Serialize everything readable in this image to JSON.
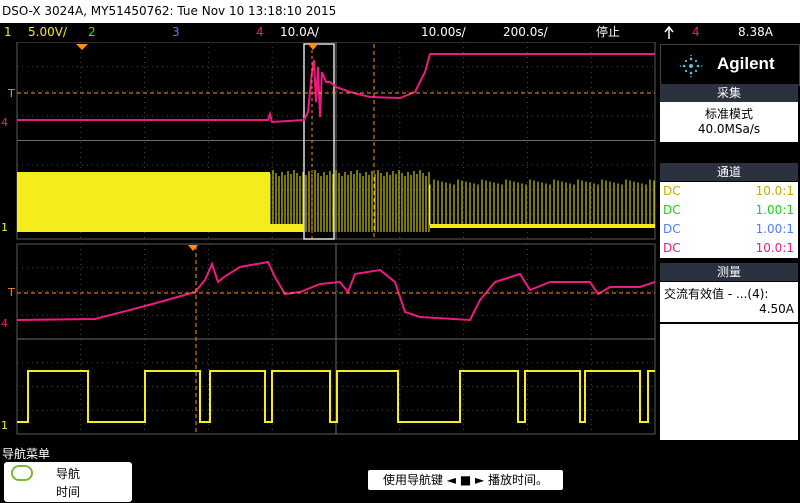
{
  "title": "DSO-X 3024A, MY51450762: Tue Nov 10 13:18:10 2015",
  "channel_bar": {
    "ch1_num": "1",
    "ch1_scale": "5.00V/",
    "ch2_num": "2",
    "ch3_num": "3",
    "ch4_num": "4",
    "ch4_scale": "10.0A/",
    "time_pos": "10.00s/",
    "time_scale": "200.0s/",
    "run_state": "停止",
    "trig_icon": "trigger-edge-icon",
    "trig_ch": "4",
    "trig_level": "8.38A"
  },
  "brand": {
    "name": "Agilent"
  },
  "acquisition": {
    "header": "采集",
    "mode": "标准模式",
    "rate": "40.0MSa/s"
  },
  "channels": {
    "header": "通道",
    "rows": [
      {
        "coupling": "DC",
        "probe": "10.0:1",
        "color": "#f4ec1b"
      },
      {
        "coupling": "DC",
        "probe": "1.00:1",
        "color": "#19f219"
      },
      {
        "coupling": "DC",
        "probe": "1.00:1",
        "color": "#4d7dff"
      },
      {
        "coupling": "DC",
        "probe": "10.0:1",
        "color": "#ee1a82"
      }
    ]
  },
  "measure": {
    "header": "测量",
    "label": "交流有效值 - ...(4):",
    "value": "4.50A"
  },
  "nav": {
    "title": "导航菜单",
    "softkey_line1": "导航",
    "softkey_line2": "时间",
    "hint": "使用导航键 ◄ ■ ► 播放时间。"
  },
  "markers": {
    "ch1": "1",
    "ch4": "4",
    "trig": "T"
  },
  "colors": {
    "ch1": "#f4ec1b",
    "ch4": "#ee1a82",
    "grid": "#4a4a4a",
    "trigline": "#ff8c1a"
  }
}
